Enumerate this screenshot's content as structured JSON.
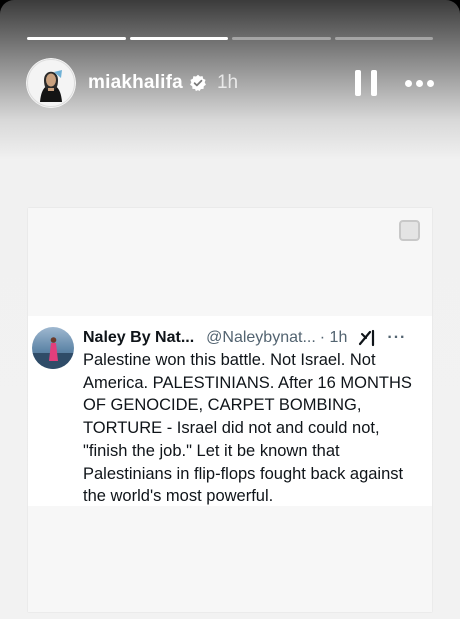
{
  "story": {
    "progress": [
      1,
      1,
      0,
      0
    ],
    "username": "miakhalifa",
    "time": "1h",
    "icons": {
      "verified": "verified-badge-icon",
      "pause": "pause-icon",
      "more": "more-options-icon"
    }
  },
  "post": {
    "save_icon": "bookmark-square-icon",
    "tweet": {
      "name": "Naley By Nat...",
      "handle": "@Naleybynat...",
      "time": "· 1h",
      "text": "Palestine won this battle. Not Israel. Not America. PALESTINIANS. After 16 MONTHS OF GENOCIDE, CARPET BOMBING, TORTURE - Israel did not and could not, \"finish the job.\" Let it be known that Palestinians in flip-flops fought back against the world's most powerful.",
      "more": "···",
      "icons": {
        "grok": "grok-icon",
        "more": "more-horizontal-icon"
      }
    }
  }
}
